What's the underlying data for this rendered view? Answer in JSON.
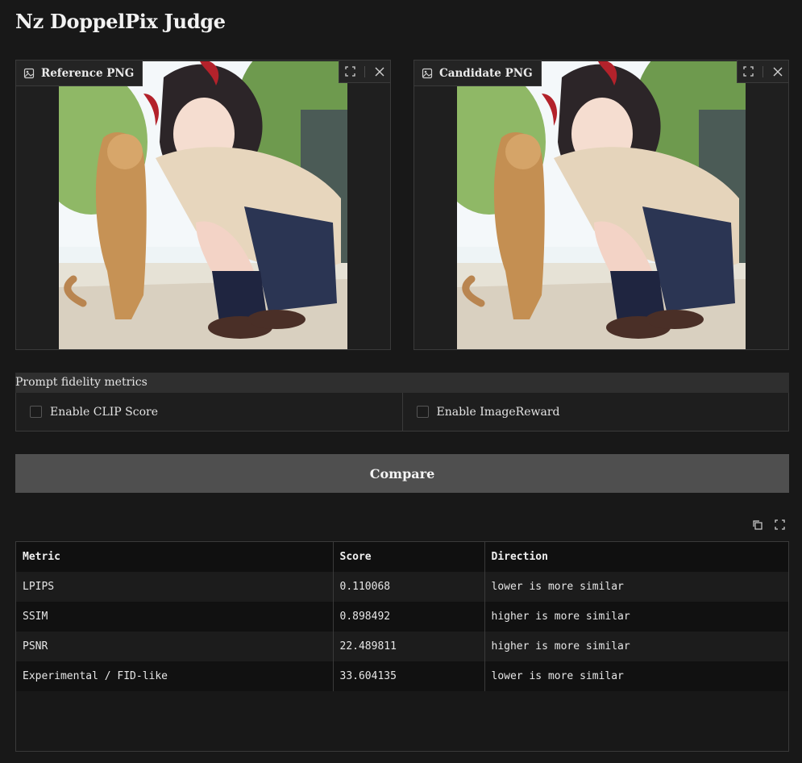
{
  "app": {
    "title": "Nz DoppelPix Judge"
  },
  "reference": {
    "label": "Reference PNG",
    "icon": "image-icon"
  },
  "candidate": {
    "label": "Candidate PNG",
    "icon": "image-icon"
  },
  "image_tools": {
    "fullscreen_icon": "fullscreen-icon",
    "close_icon": "close-icon"
  },
  "prompt_fidelity": {
    "header": "Prompt fidelity metrics",
    "clip_label": "Enable CLIP Score",
    "clip_checked": false,
    "imagereward_label": "Enable ImageReward",
    "imagereward_checked": false
  },
  "compare_button": "Compare",
  "results": {
    "tools": [
      "copy-icon",
      "fullscreen-icon"
    ],
    "columns": [
      "Metric",
      "Score",
      "Direction"
    ],
    "rows": [
      [
        "LPIPS",
        "0.110068",
        "lower is more similar"
      ],
      [
        "SSIM",
        "0.898492",
        "higher is more similar"
      ],
      [
        "PSNR",
        "22.489811",
        "higher is more similar"
      ],
      [
        "Experimental / FID-like",
        "33.604135",
        "lower is more similar"
      ]
    ]
  },
  "colors": {
    "background": "#181818",
    "button": "#4f4f4f",
    "header_bar": "#2f2f2f"
  }
}
